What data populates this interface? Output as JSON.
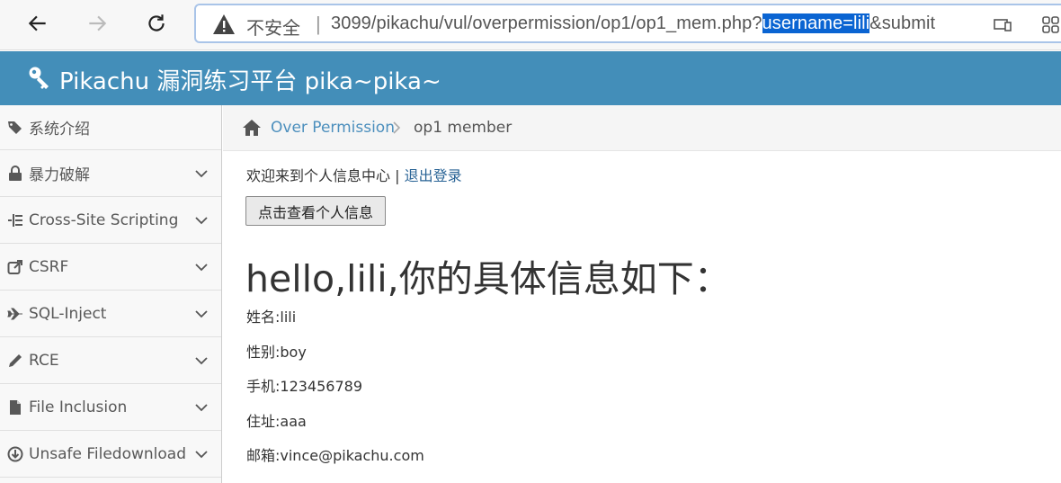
{
  "browser": {
    "security_label": "不安全",
    "separator": "|",
    "url_prefix": "3099/pikachu/vul/overpermission/op1/op1_mem.php?",
    "url_selected": "username=lili",
    "url_suffix": "&submit",
    "selection_color": "#0a64d2"
  },
  "header": {
    "title": "Pikachu 漏洞练习平台 pika~pika~",
    "bg_color": "#438eb9"
  },
  "sidebar": {
    "items": [
      {
        "label": "系统介绍",
        "icon": "tags-icon",
        "expandable": false
      },
      {
        "label": "暴力破解",
        "icon": "lock-icon",
        "expandable": true
      },
      {
        "label": "Cross-Site Scripting",
        "icon": "list-icon",
        "expandable": true
      },
      {
        "label": "CSRF",
        "icon": "share-icon",
        "expandable": true
      },
      {
        "label": "SQL-Inject",
        "icon": "plane-icon",
        "expandable": true
      },
      {
        "label": "RCE",
        "icon": "pencil-icon",
        "expandable": true
      },
      {
        "label": "File Inclusion",
        "icon": "file-icon",
        "expandable": true
      },
      {
        "label": "Unsafe Filedownload",
        "icon": "download-icon",
        "expandable": true
      }
    ]
  },
  "breadcrumb": {
    "parent": "Over Permission",
    "current": "op1 member"
  },
  "main": {
    "welcome_text": "欢迎来到个人信息中心",
    "welcome_sep": " | ",
    "logout_label": "退出登录",
    "view_button": "点击查看个人信息",
    "heading": "hello,lili,你的具体信息如下：",
    "fields": [
      {
        "label": "姓名:lili"
      },
      {
        "label": "性别:boy"
      },
      {
        "label": "手机:123456789"
      },
      {
        "label": "住址:aaa"
      },
      {
        "label": "邮箱:vince@pikachu.com"
      }
    ]
  }
}
